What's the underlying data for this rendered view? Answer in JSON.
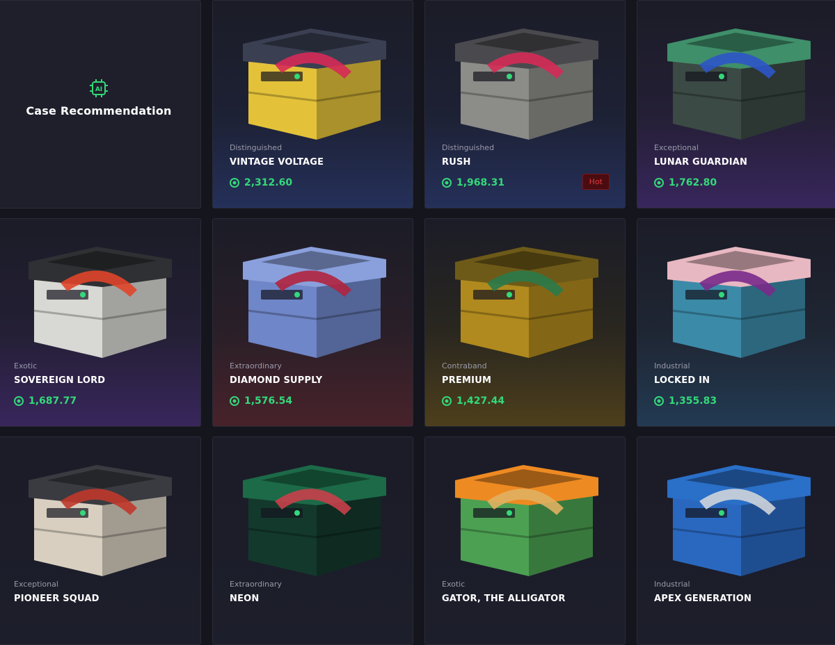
{
  "recommendation": {
    "badge": "AI",
    "title": "Case Recommendation"
  },
  "cases": [
    {
      "rarity": "Distinguished",
      "name": "VINTAGE VOLTAGE",
      "price": "2,312.60",
      "body_color": "#e3c23a",
      "lid_color": "#3a3f52",
      "accent": "#d62a57"
    },
    {
      "rarity": "Distinguished",
      "name": "RUSH",
      "price": "1,968.31",
      "badge": "Hot",
      "body_color": "#8c8c88",
      "lid_color": "#4a4a4e",
      "accent": "#d62a57"
    },
    {
      "rarity": "Exceptional",
      "name": "LUNAR GUARDIAN",
      "price": "1,762.80",
      "body_color": "#3b4a44",
      "lid_color": "#3f8f6a",
      "accent": "#2d55c8"
    },
    {
      "rarity": "Exotic",
      "name": "SOVEREIGN LORD",
      "price": "1,687.77",
      "body_color": "#d8d8d4",
      "lid_color": "#2f3033",
      "accent": "#e0452a"
    },
    {
      "rarity": "Extraordinary",
      "name": "DIAMOND SUPPLY",
      "price": "1,576.54",
      "body_color": "#6f86c8",
      "lid_color": "#8aa0dc",
      "accent": "#b0243f"
    },
    {
      "rarity": "Contraband",
      "name": "PREMIUM",
      "price": "1,427.44",
      "body_color": "#b08a1e",
      "lid_color": "#6e5a18",
      "accent": "#2a7a4a"
    },
    {
      "rarity": "Industrial",
      "name": "LOCKED IN",
      "price": "1,355.83",
      "body_color": "#3b8aa8",
      "lid_color": "#e8b8c2",
      "accent": "#7a2a8a"
    },
    {
      "rarity": "Exceptional",
      "name": "PIONEER SQUAD",
      "price": "",
      "body_color": "#d8cfc0",
      "lid_color": "#3a3b40",
      "accent": "#c0392b"
    },
    {
      "rarity": "Extraordinary",
      "name": "NEON",
      "price": "",
      "body_color": "#13392c",
      "lid_color": "#1c6a48",
      "accent": "#c8404a"
    },
    {
      "rarity": "Exotic",
      "name": "GATOR, THE ALLIGATOR",
      "price": "",
      "body_color": "#4ca052",
      "lid_color": "#ee8a22",
      "accent": "#e0b060"
    },
    {
      "rarity": "Industrial",
      "name": "APEX GENERATION",
      "price": "",
      "body_color": "#2a68c0",
      "lid_color": "#2a6fc8",
      "accent": "#cfd4da"
    }
  ],
  "currency_icon": "coin-icon",
  "colors": {
    "price": "#34d97a",
    "ai_accent": "#34d97a",
    "hot_bg": "#4a0c10",
    "hot_text": "#e0383e"
  }
}
